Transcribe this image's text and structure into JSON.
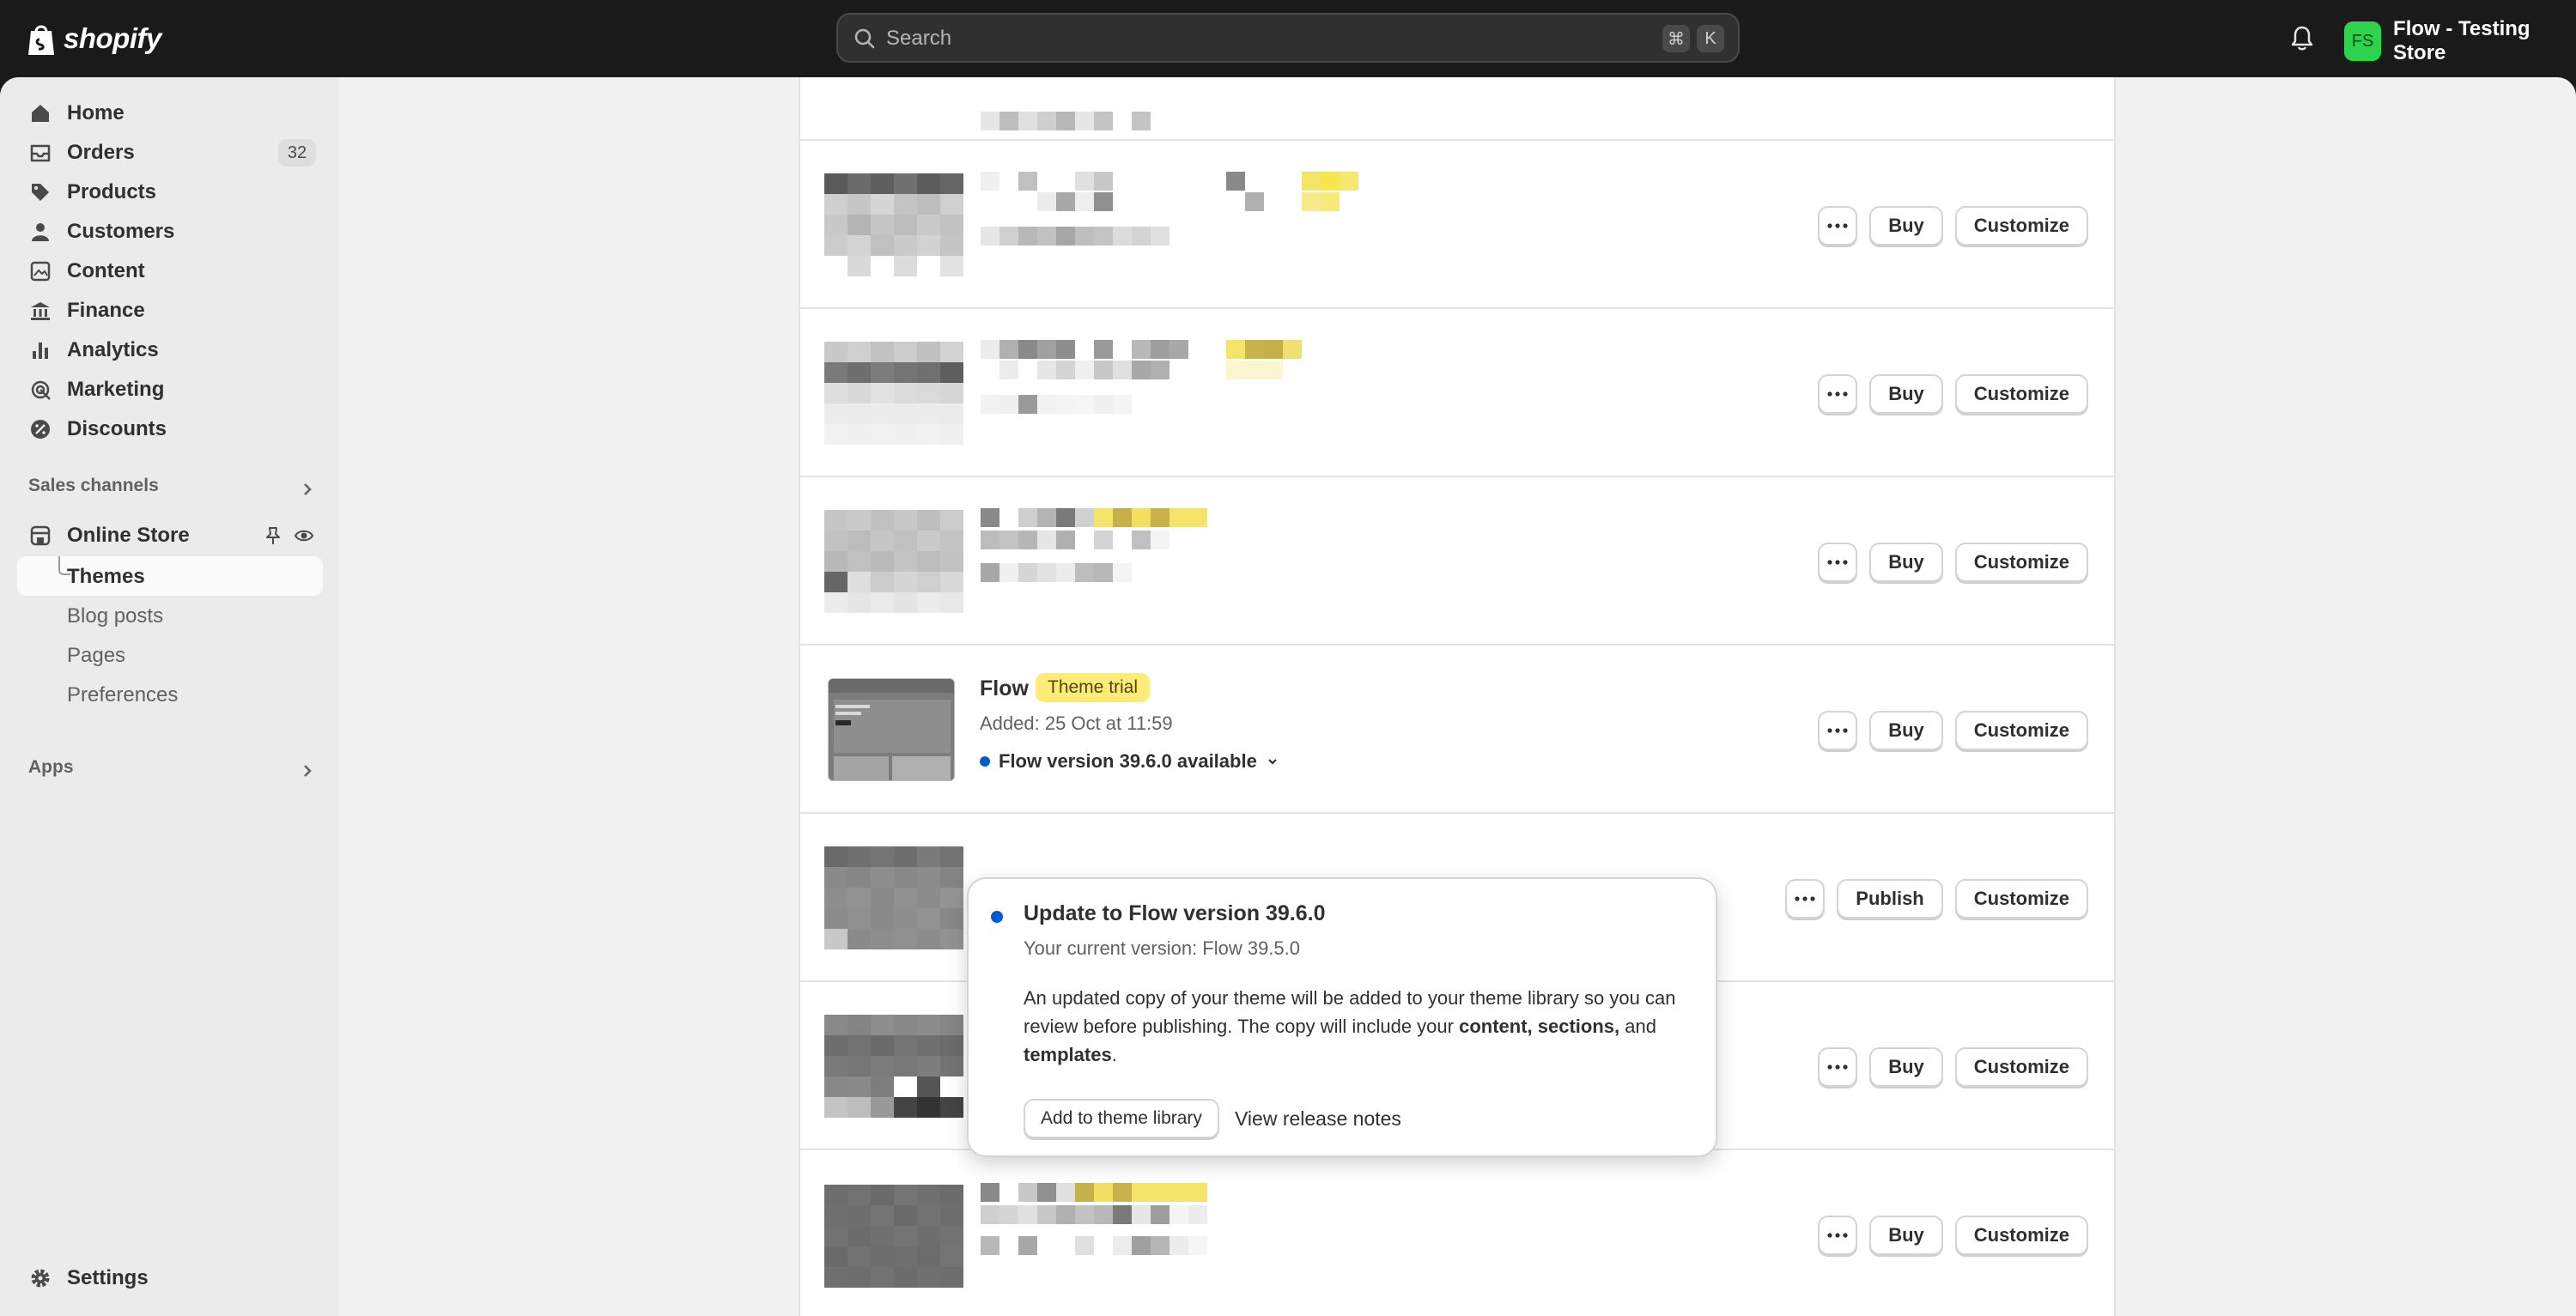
{
  "topbar": {
    "brand": "shopify",
    "search_placeholder": "Search",
    "shortcut_cmd": "⌘",
    "shortcut_key": "K",
    "store_initials": "FS",
    "store_name": "Flow - Testing Store",
    "avatar_color": "#2bd44c"
  },
  "sidebar": {
    "items": [
      {
        "label": "Home",
        "icon": "home-icon"
      },
      {
        "label": "Orders",
        "icon": "inbox-icon",
        "count": "32"
      },
      {
        "label": "Products",
        "icon": "tag-icon"
      },
      {
        "label": "Customers",
        "icon": "person-icon"
      },
      {
        "label": "Content",
        "icon": "content-icon"
      },
      {
        "label": "Finance",
        "icon": "bank-icon"
      },
      {
        "label": "Analytics",
        "icon": "bar-chart-icon"
      },
      {
        "label": "Marketing",
        "icon": "target-icon"
      },
      {
        "label": "Discounts",
        "icon": "discount-icon"
      }
    ],
    "sales_channels_label": "Sales channels",
    "online_store_label": "Online Store",
    "online_store_subitems": [
      "Themes",
      "Blog posts",
      "Pages",
      "Preferences"
    ],
    "apps_label": "Apps",
    "settings_label": "Settings"
  },
  "themes": {
    "buy_label": "Buy",
    "customize_label": "Customize",
    "publish_label": "Publish",
    "flow": {
      "name": "Flow",
      "badge": "Theme trial",
      "added": "Added: 25 Oct at 11:59",
      "version_notice": "Flow version 39.6.0 available"
    }
  },
  "popover": {
    "title": "Update to Flow version 39.6.0",
    "current_version": "Your current version: Flow 39.5.0",
    "body_part1": "An updated copy of your theme will be added to your theme library so you can review before publishing. The copy will include your ",
    "body_bold1": "content, sections,",
    "body_part2": " and ",
    "body_bold2": "templates",
    "body_part3": ".",
    "add_button": "Add to theme library",
    "release_notes_link": "View release notes"
  },
  "colors": {
    "accent_blue": "#005bd3",
    "trial_badge_bg": "#ffeb78",
    "topbar_bg": "#1a1a1a"
  }
}
